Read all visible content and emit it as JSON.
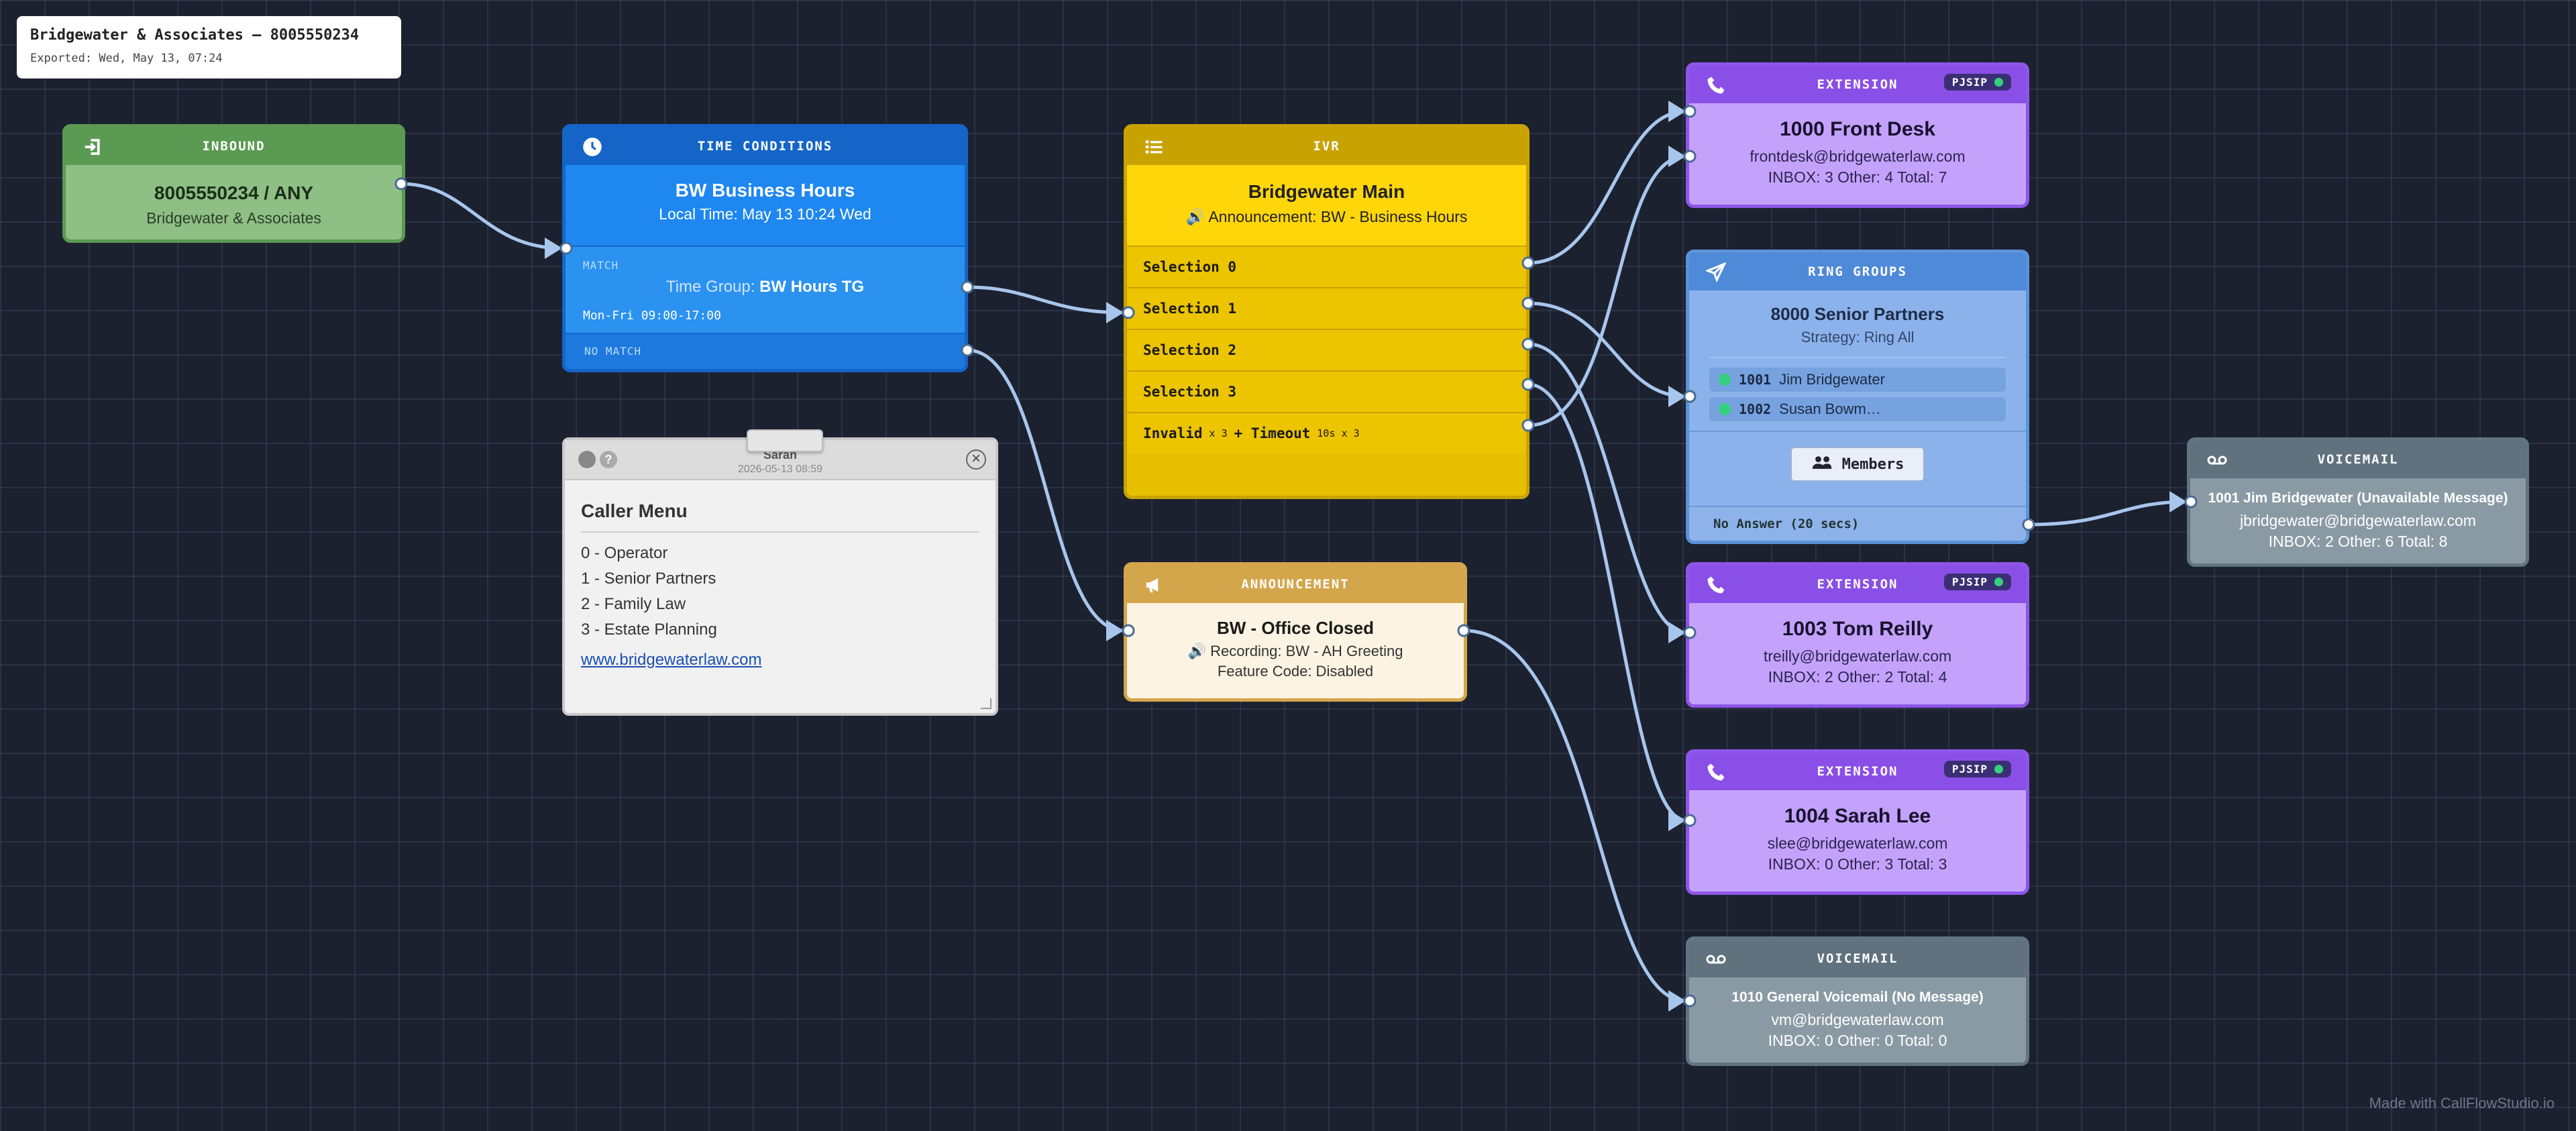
{
  "export": {
    "title": "Bridgewater & Associates — 8005550234",
    "date": "Exported: Wed, May 13, 07:24"
  },
  "inbound": {
    "header": "INBOUND",
    "number": "8005550234 / ANY",
    "name": "Bridgewater & Associates",
    "icon": "sign-in-icon",
    "color": "#5b9a52"
  },
  "time_conditions": {
    "header": "TIME CONDITIONS",
    "name": "BW Business Hours",
    "local_time": "Local Time: May 13 10:24 Wed",
    "match_label": "MATCH",
    "time_group_label": "Time Group:",
    "time_group": "BW Hours TG",
    "schedule": "Mon-Fri 09:00-17:00",
    "no_match_label": "NO MATCH",
    "icon": "clock-icon",
    "color": "#1565c9"
  },
  "note": {
    "author": "Sarah",
    "timestamp": "2026-05-13 08:59",
    "title": "Caller Menu",
    "lines": [
      "0 - Operator",
      "1 - Senior Partners",
      "2 - Family Law",
      "3 - Estate Planning"
    ],
    "link": "www.bridgewaterlaw.com",
    "help": "?",
    "close": "×"
  },
  "ivr": {
    "header": "IVR",
    "name": "Bridgewater Main",
    "announcement": "Announcement: BW - Business Hours",
    "selections": [
      "Selection 0",
      "Selection 1",
      "Selection 2",
      "Selection 3"
    ],
    "invalid_label": "Invalid",
    "invalid_count": "x 3",
    "timeout_label": "+ Timeout",
    "timeout_detail": "10s x 3",
    "icon": "list-icon",
    "color": "#c8a200"
  },
  "announcement": {
    "header": "ANNOUNCEMENT",
    "name": "BW - Office Closed",
    "recording": "Recording: BW - AH Greeting",
    "feature_code": "Feature Code: Disabled",
    "icon": "megaphone-icon"
  },
  "extensions": [
    {
      "header": "EXTENSION",
      "badge": "PJSIP",
      "name": "1000 Front Desk",
      "email": "frontdesk@bridgewaterlaw.com",
      "counts": "INBOX: 3 Other: 4 Total: 7"
    },
    {
      "header": "EXTENSION",
      "badge": "PJSIP",
      "name": "1003 Tom Reilly",
      "email": "treilly@bridgewaterlaw.com",
      "counts": "INBOX: 2 Other: 2 Total: 4"
    },
    {
      "header": "EXTENSION",
      "badge": "PJSIP",
      "name": "1004 Sarah Lee",
      "email": "slee@bridgewaterlaw.com",
      "counts": "INBOX: 0 Other: 3 Total: 3"
    }
  ],
  "ring_group": {
    "header": "RING GROUPS",
    "name": "8000 Senior Partners",
    "strategy": "Strategy: Ring All",
    "members": [
      {
        "ext": "1001",
        "name": "Jim Bridgewater"
      },
      {
        "ext": "1002",
        "name": "Susan Bowm…"
      }
    ],
    "members_button": "Members",
    "no_answer": "No Answer (20 secs)",
    "icon": "send-icon"
  },
  "voicemails": [
    {
      "header": "VOICEMAIL",
      "name": "1001 Jim Bridgewater (Unavailable Message)",
      "email": "jbridgewater@bridgewaterlaw.com",
      "counts": "INBOX: 2 Other: 6 Total: 8"
    },
    {
      "header": "VOICEMAIL",
      "name": "1010 General Voicemail (No Message)",
      "email": "vm@bridgewaterlaw.com",
      "counts": "INBOX: 0 Other: 0 Total: 0"
    }
  ],
  "footer": "Made with CallFlowStudio.io",
  "colors": {
    "background": "#1c2130",
    "wire": "#a8c6ec",
    "status_online": "#35d07f"
  }
}
